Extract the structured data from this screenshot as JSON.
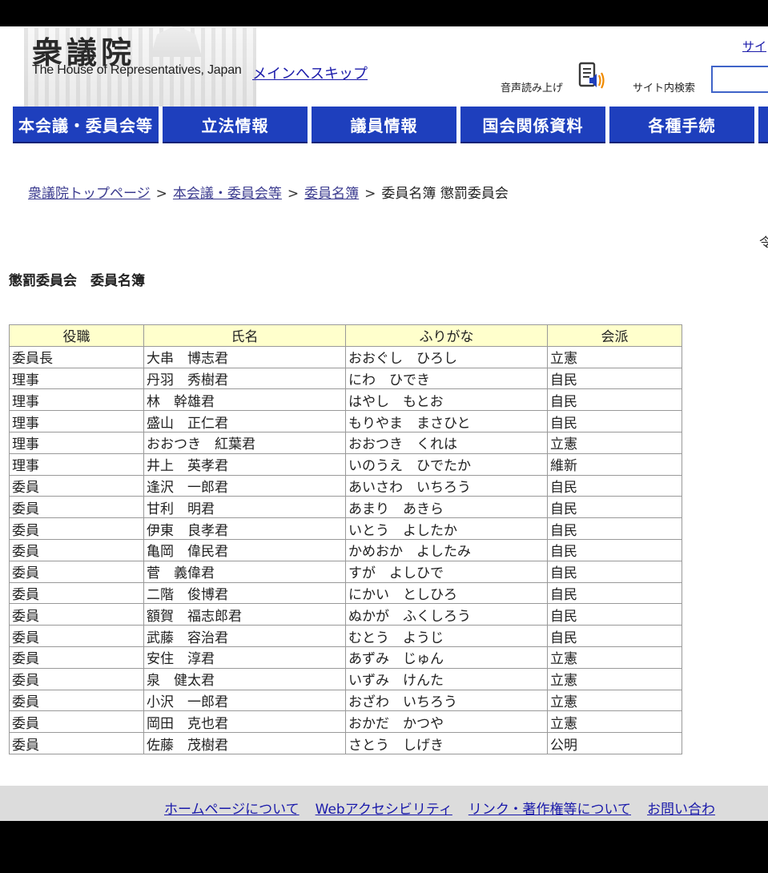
{
  "header": {
    "logo_kanji": "衆議院",
    "logo_en": "The House of Representatives, Japan",
    "skip_link": "メインへスキップ",
    "site_link": "サイ",
    "voice_label": "音声読み上げ",
    "search_label": "サイト内検索",
    "search_value": ""
  },
  "nav": {
    "items": [
      "本会議・委員会等",
      "立法情報",
      "議員情報",
      "国会関係資料",
      "各種手続"
    ]
  },
  "breadcrumb": {
    "items": [
      "衆議院トップページ",
      "本会議・委員会等",
      "委員名簿"
    ],
    "current": "委員名簿 懲罰委員会",
    "separator": ">"
  },
  "edge_text": "令",
  "page_title": "懲罰委員会　委員名簿",
  "table": {
    "headers": [
      "役職",
      "氏名",
      "ふりがな",
      "会派"
    ],
    "rows": [
      [
        "委員長",
        "大串　博志君",
        "おおぐし　ひろし",
        "立憲"
      ],
      [
        "理事",
        "丹羽　秀樹君",
        "にわ　ひでき",
        "自民"
      ],
      [
        "理事",
        "林　幹雄君",
        "はやし　もとお",
        "自民"
      ],
      [
        "理事",
        "盛山　正仁君",
        "もりやま　まさひと",
        "自民"
      ],
      [
        "理事",
        "おおつき　紅葉君",
        "おおつき　くれは",
        "立憲"
      ],
      [
        "理事",
        "井上　英孝君",
        "いのうえ　ひでたか",
        "維新"
      ],
      [
        "委員",
        "逢沢　一郎君",
        "あいさわ　いちろう",
        "自民"
      ],
      [
        "委員",
        "甘利　明君",
        "あまり　あきら",
        "自民"
      ],
      [
        "委員",
        "伊東　良孝君",
        "いとう　よしたか",
        "自民"
      ],
      [
        "委員",
        "亀岡　偉民君",
        "かめおか　よしたみ",
        "自民"
      ],
      [
        "委員",
        "菅　義偉君",
        "すが　よしひで",
        "自民"
      ],
      [
        "委員",
        "二階　俊博君",
        "にかい　としひろ",
        "自民"
      ],
      [
        "委員",
        "額賀　福志郎君",
        "ぬかが　ふくしろう",
        "自民"
      ],
      [
        "委員",
        "武藤　容治君",
        "むとう　ようじ",
        "自民"
      ],
      [
        "委員",
        "安住　淳君",
        "あずみ　じゅん",
        "立憲"
      ],
      [
        "委員",
        "泉　健太君",
        "いずみ　けんた",
        "立憲"
      ],
      [
        "委員",
        "小沢　一郎君",
        "おざわ　いちろう",
        "立憲"
      ],
      [
        "委員",
        "岡田　克也君",
        "おかだ　かつや",
        "立憲"
      ],
      [
        "委員",
        "佐藤　茂樹君",
        "さとう　しげき",
        "公明"
      ]
    ]
  },
  "footer": {
    "links": [
      "ホームページについて",
      "Webアクセシビリティ",
      "リンク・著作権等について",
      "お問い合わ"
    ]
  },
  "colors": {
    "nav_bg": "#1e3fbd",
    "table_header_bg": "#ffffcc",
    "link": "#1a1aaa",
    "footer_bg": "#dcdcdc"
  },
  "icons": {
    "voice": "speaker-icon"
  }
}
